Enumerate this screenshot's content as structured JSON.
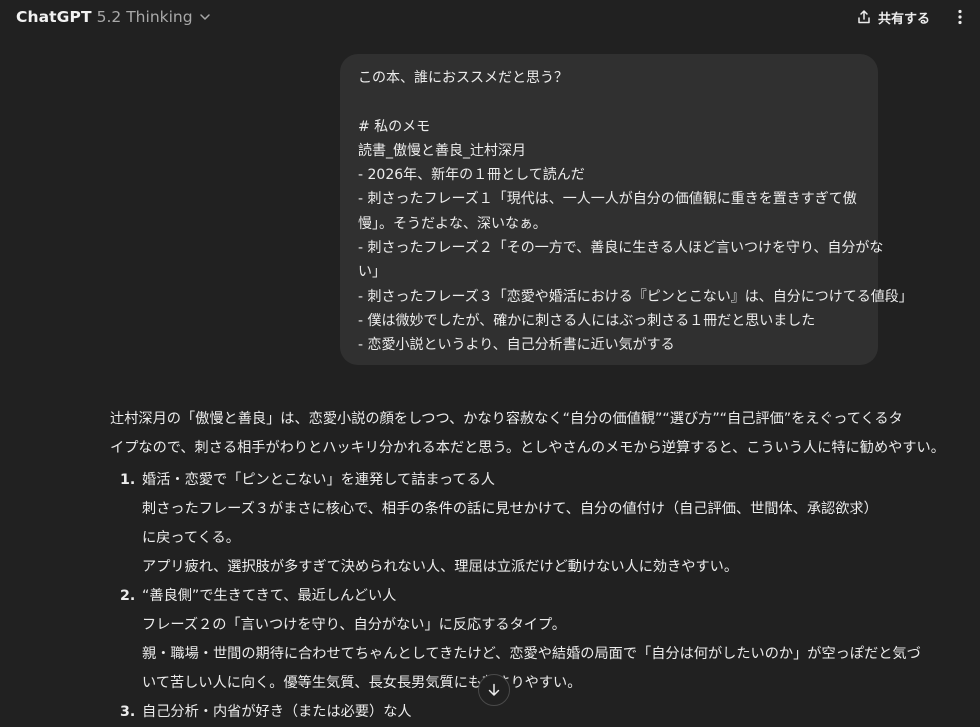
{
  "header": {
    "model_name": "ChatGPT",
    "model_version": "5.2 Thinking",
    "share_label": "共有する"
  },
  "user_message": {
    "lines": [
      "この本、誰におススメだと思う？",
      "",
      "# 私のメモ",
      "読書_傲慢と善良_辻村深月",
      "- 2026年、新年の１冊として読んだ",
      "- 刺さったフレーズ１「現代は、一人一人が自分の価値観に重きを置きすぎて傲",
      "慢」。そうだよな、深いなぁ。",
      "- 刺さったフレーズ２「その一方で、善良に生きる人ほど言いつけを守り、自分がな",
      "い」",
      "- 刺さったフレーズ３「恋愛や婚活における『ピンとこない』は、自分につけてる値段」",
      "- 僕は微妙でしたが、確かに刺さる人にはぶっ刺さる１冊だと思いました",
      "- 恋愛小説というより、自己分析書に近い気がする"
    ]
  },
  "assistant_message": {
    "intro_lines": [
      "辻村深月の「傲慢と善良」は、恋愛小説の顔をしつつ、かなり容赦なく“自分の価値観”“選び方”“自己評価”をえぐってくるタ",
      "イプなので、刺さる相手がわりとハッキリ分かれる本だと思う。としやさんのメモから逆算すると、こういう人に特に勧めやすい。"
    ],
    "list": [
      {
        "number": "1.",
        "lines": [
          "婚活・恋愛で「ピンとこない」を連発して詰まってる人",
          "刺さったフレーズ３がまさに核心で、相手の条件の話に見せかけて、自分の値付け（自己評価、世間体、承認欲求）",
          "に戻ってくる。",
          "アプリ疲れ、選択肢が多すぎて決められない人、理屈は立派だけど動けない人に効きやすい。"
        ]
      },
      {
        "number": "2.",
        "lines": [
          "“善良側”で生きてきて、最近しんどい人",
          "フレーズ２の「言いつけを守り、自分がない」に反応するタイプ。",
          "親・職場・世間の期待に合わせてちゃんとしてきたけど、恋愛や結婚の局面で「自分は何がしたいのか」が空っぽだと気づ",
          "いて苦しい人に向く。優等生気質、長女長男気質にも刺さりやすい。"
        ]
      },
      {
        "number": "3.",
        "lines": [
          "自己分析・内省が好き（または必要）な人"
        ]
      }
    ]
  },
  "icons": {
    "chevron": "chevron-down-icon",
    "share": "share-icon",
    "more": "more-dots-icon",
    "scroll": "arrow-down-icon"
  },
  "colors": {
    "background": "#212121",
    "bubble": "#303030",
    "text": "#ececec",
    "muted": "#a8a8a8"
  }
}
